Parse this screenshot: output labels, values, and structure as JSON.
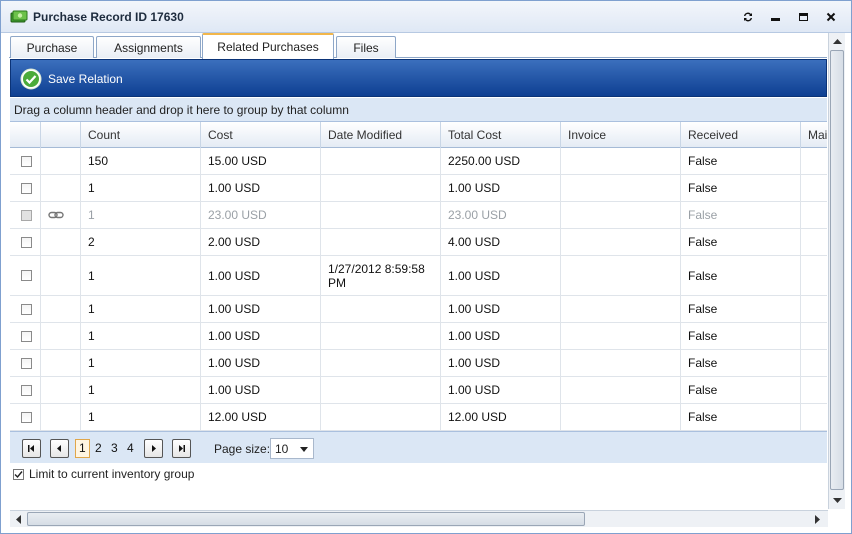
{
  "window": {
    "title": "Purchase Record ID 17630"
  },
  "tabs": [
    {
      "label": "Purchase"
    },
    {
      "label": "Assignments"
    },
    {
      "label": "Related Purchases"
    },
    {
      "label": "Files"
    }
  ],
  "toolbar": {
    "save_label": "Save Relation"
  },
  "group_panel": {
    "text": "Drag a column header and drop it here to group by that column"
  },
  "grid": {
    "columns": [
      "",
      "",
      "Count",
      "Cost",
      "Date Modified",
      "Total Cost",
      "Invoice",
      "Received",
      "Mai"
    ],
    "rows": [
      {
        "count": "150",
        "cost": "15.00 USD",
        "date_modified": "",
        "total_cost": "2250.00 USD",
        "invoice": "",
        "received": "False",
        "linked": false,
        "disabled": false
      },
      {
        "count": "1",
        "cost": "1.00 USD",
        "date_modified": "",
        "total_cost": "1.00 USD",
        "invoice": "",
        "received": "False",
        "linked": false,
        "disabled": false
      },
      {
        "count": "1",
        "cost": "23.00 USD",
        "date_modified": "",
        "total_cost": "23.00 USD",
        "invoice": "",
        "received": "False",
        "linked": true,
        "disabled": true
      },
      {
        "count": "2",
        "cost": "2.00 USD",
        "date_modified": "",
        "total_cost": "4.00 USD",
        "invoice": "",
        "received": "False",
        "linked": false,
        "disabled": false
      },
      {
        "count": "1",
        "cost": "1.00 USD",
        "date_modified": "1/27/2012 8:59:58 PM",
        "total_cost": "1.00 USD",
        "invoice": "",
        "received": "False",
        "linked": false,
        "disabled": false
      },
      {
        "count": "1",
        "cost": "1.00 USD",
        "date_modified": "",
        "total_cost": "1.00 USD",
        "invoice": "",
        "received": "False",
        "linked": false,
        "disabled": false
      },
      {
        "count": "1",
        "cost": "1.00 USD",
        "date_modified": "",
        "total_cost": "1.00 USD",
        "invoice": "",
        "received": "False",
        "linked": false,
        "disabled": false
      },
      {
        "count": "1",
        "cost": "1.00 USD",
        "date_modified": "",
        "total_cost": "1.00 USD",
        "invoice": "",
        "received": "False",
        "linked": false,
        "disabled": false
      },
      {
        "count": "1",
        "cost": "1.00 USD",
        "date_modified": "",
        "total_cost": "1.00 USD",
        "invoice": "",
        "received": "False",
        "linked": false,
        "disabled": false
      },
      {
        "count": "1",
        "cost": "12.00 USD",
        "date_modified": "",
        "total_cost": "12.00 USD",
        "invoice": "",
        "received": "False",
        "linked": false,
        "disabled": false
      }
    ]
  },
  "pager": {
    "pages": [
      "1",
      "2",
      "3",
      "4"
    ],
    "current_page": "1",
    "page_size_label": "Page size:",
    "page_size": "10"
  },
  "limit": {
    "label": "Limit to current inventory group",
    "checked": true
  },
  "colors": {
    "toolbar_blue": "#1b4fa0",
    "tab_accent": "#f2b64a",
    "panel_blue": "#dbe7f5"
  }
}
